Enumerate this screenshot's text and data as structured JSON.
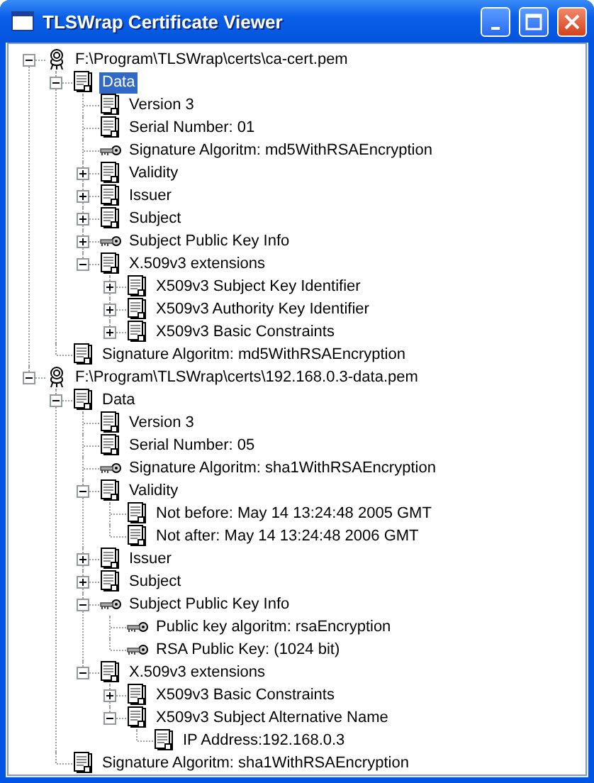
{
  "window": {
    "title": "TLSWrap Certificate Viewer"
  },
  "tree": [
    {
      "label": "F:\\Program\\TLSWrap\\certs\\ca-cert.pem",
      "kind": "cert",
      "expanded": true,
      "selected": false,
      "children": [
        {
          "label": "Data",
          "kind": "doc",
          "expanded": true,
          "selected": true,
          "children": [
            {
              "label": "Version 3",
              "kind": "doc",
              "selected": false
            },
            {
              "label": "Serial Number: 01",
              "kind": "doc",
              "selected": false
            },
            {
              "label": "Signature Algoritm: md5WithRSAEncryption",
              "kind": "key",
              "selected": false
            },
            {
              "label": "Validity",
              "kind": "doc",
              "expanded": false,
              "selected": false
            },
            {
              "label": "Issuer",
              "kind": "doc",
              "expanded": false,
              "selected": false
            },
            {
              "label": "Subject",
              "kind": "doc",
              "expanded": false,
              "selected": false
            },
            {
              "label": "Subject Public Key Info",
              "kind": "key",
              "expanded": false,
              "selected": false
            },
            {
              "label": "X.509v3 extensions",
              "kind": "doc",
              "expanded": true,
              "selected": false,
              "children": [
                {
                  "label": "X509v3 Subject Key Identifier",
                  "kind": "doc",
                  "expanded": false,
                  "selected": false
                },
                {
                  "label": "X509v3 Authority Key Identifier",
                  "kind": "doc",
                  "expanded": false,
                  "selected": false
                },
                {
                  "label": "X509v3 Basic Constraints",
                  "kind": "doc",
                  "expanded": false,
                  "selected": false
                }
              ]
            }
          ]
        },
        {
          "label": "Signature Algoritm: md5WithRSAEncryption",
          "kind": "doc",
          "selected": false
        }
      ]
    },
    {
      "label": "F:\\Program\\TLSWrap\\certs\\192.168.0.3-data.pem",
      "kind": "cert",
      "expanded": true,
      "selected": false,
      "children": [
        {
          "label": "Data",
          "kind": "doc",
          "expanded": true,
          "selected": false,
          "children": [
            {
              "label": "Version 3",
              "kind": "doc",
              "selected": false
            },
            {
              "label": "Serial Number: 05",
              "kind": "doc",
              "selected": false
            },
            {
              "label": "Signature Algoritm: sha1WithRSAEncryption",
              "kind": "key",
              "selected": false
            },
            {
              "label": "Validity",
              "kind": "doc",
              "expanded": true,
              "selected": false,
              "children": [
                {
                  "label": "Not before: May 14 13:24:48 2005 GMT",
                  "kind": "doc",
                  "selected": false
                },
                {
                  "label": "Not after: May 14 13:24:48 2006 GMT",
                  "kind": "doc",
                  "selected": false
                }
              ]
            },
            {
              "label": "Issuer",
              "kind": "doc",
              "expanded": false,
              "selected": false
            },
            {
              "label": "Subject",
              "kind": "doc",
              "expanded": false,
              "selected": false
            },
            {
              "label": "Subject Public Key Info",
              "kind": "key",
              "expanded": true,
              "selected": false,
              "children": [
                {
                  "label": "Public key algoritm: rsaEncryption",
                  "kind": "key",
                  "selected": false
                },
                {
                  "label": "RSA Public Key: (1024 bit)",
                  "kind": "key",
                  "selected": false
                }
              ]
            },
            {
              "label": "X.509v3 extensions",
              "kind": "doc",
              "expanded": true,
              "selected": false,
              "children": [
                {
                  "label": "X509v3 Basic Constraints",
                  "kind": "doc",
                  "expanded": false,
                  "selected": false
                },
                {
                  "label": "X509v3 Subject Alternative Name",
                  "kind": "doc",
                  "expanded": true,
                  "selected": false,
                  "children": [
                    {
                      "label": "IP Address:192.168.0.3",
                      "kind": "doc",
                      "selected": false
                    }
                  ]
                }
              ]
            }
          ]
        },
        {
          "label": "Signature Algoritm: sha1WithRSAEncryption",
          "kind": "doc",
          "selected": false
        }
      ]
    }
  ]
}
